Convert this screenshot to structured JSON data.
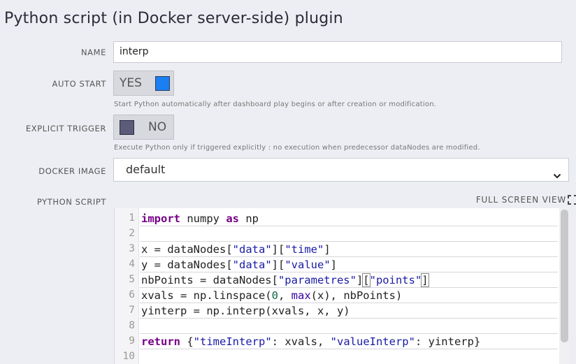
{
  "title": "Python script (in Docker server-side) plugin",
  "fields": {
    "name_label": "NAME",
    "name_value": "interp",
    "auto_start_label": "AUTO START",
    "auto_start_value": "YES",
    "auto_start_hint": "Start Python automatically after dashboard play begins or after creation or modification.",
    "explicit_trigger_label": "EXPLICIT TRIGGER",
    "explicit_trigger_value": "NO",
    "explicit_trigger_hint": "Execute Python only if triggered explicitly : no execution when predecessor dataNodes are modified.",
    "docker_image_label": "DOCKER IMAGE",
    "docker_image_value": "default",
    "python_script_label": "PYTHON SCRIPT",
    "full_screen_label": "FULL SCREEN VIEW"
  },
  "colors": {
    "toggle_on": "#1b7ff2",
    "toggle_off": "#5d5b7a"
  },
  "code": {
    "line_numbers": [
      "1",
      "2",
      "3",
      "4",
      "5",
      "6",
      "7",
      "8",
      "9",
      "10"
    ],
    "lines": [
      "import numpy as np",
      "",
      "x = dataNodes[\"data\"][\"time\"]",
      "y = dataNodes[\"data\"][\"value\"]",
      "nbPoints = dataNodes[\"parametres\"][\"points\"]",
      "xvals = np.linspace(0, max(x), nbPoints)",
      "yinterp = np.interp(xvals, x, y)",
      "",
      "return {\"timeInterp\": xvals, \"valueInterp\": yinterp}",
      ""
    ]
  }
}
